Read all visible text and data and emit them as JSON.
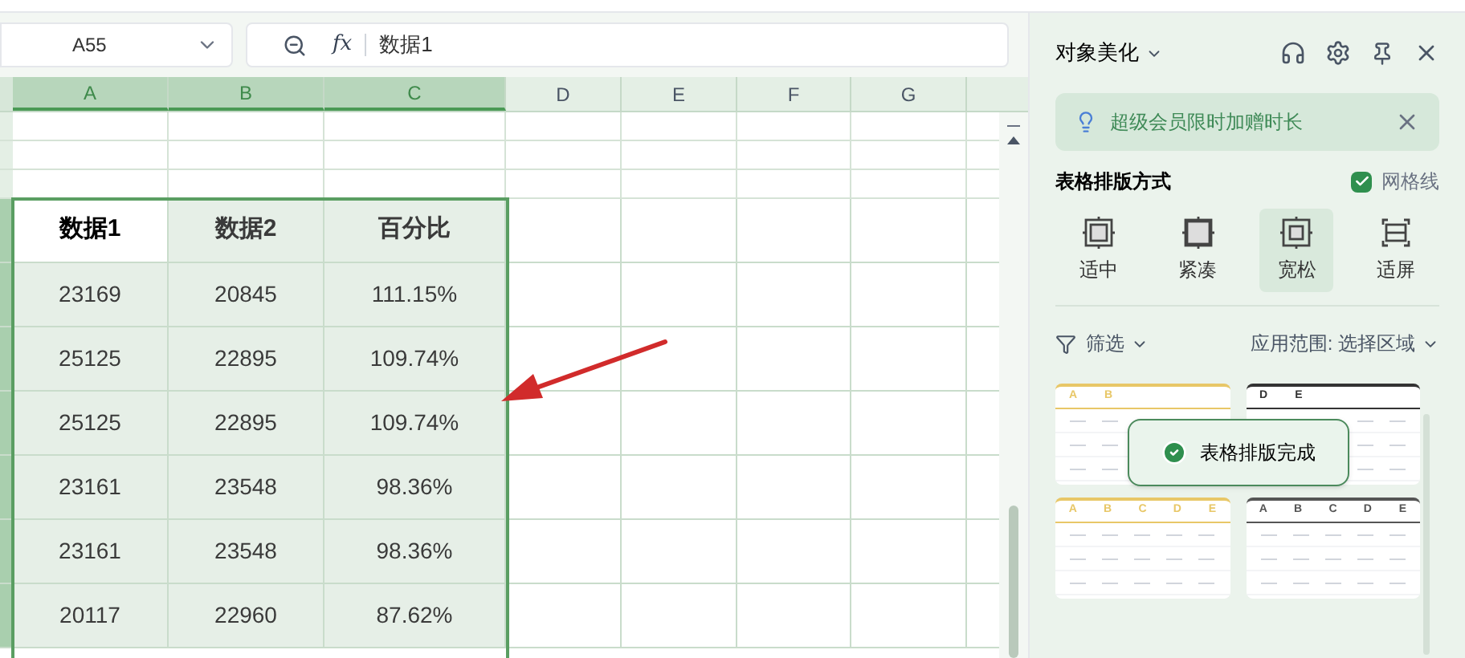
{
  "name_box": {
    "value": "A55"
  },
  "formula_bar": {
    "fx_label": "fx",
    "value": "数据1"
  },
  "columns": [
    {
      "label": "A",
      "selected": true
    },
    {
      "label": "B",
      "selected": true
    },
    {
      "label": "C",
      "selected": true
    },
    {
      "label": "D",
      "selected": false
    },
    {
      "label": "E",
      "selected": false
    },
    {
      "label": "F",
      "selected": false
    },
    {
      "label": "G",
      "selected": false
    }
  ],
  "table": {
    "headers": [
      "数据1",
      "数据2",
      "百分比"
    ],
    "rows": [
      [
        "23169",
        "20845",
        "111.15%"
      ],
      [
        "25125",
        "22895",
        "109.74%"
      ],
      [
        "25125",
        "22895",
        "109.74%"
      ],
      [
        "23161",
        "23548",
        "98.36%"
      ],
      [
        "23161",
        "23548",
        "98.36%"
      ],
      [
        "20117",
        "22960",
        "87.62%"
      ]
    ]
  },
  "panel": {
    "title": "对象美化",
    "banner": "超级会员限时加赠时长",
    "section_title": "表格排版方式",
    "gridlines": {
      "label": "网格线",
      "checked": true
    },
    "layouts": [
      {
        "label": "适中",
        "kind": "medium",
        "selected": false
      },
      {
        "label": "紧凑",
        "kind": "compact",
        "selected": false
      },
      {
        "label": "宽松",
        "kind": "loose",
        "selected": true
      },
      {
        "label": "适屏",
        "kind": "fit",
        "selected": false
      }
    ],
    "filter": "筛选",
    "scope": "应用范围: 选择区域",
    "thumbnails": [
      {
        "letters": [
          "A",
          "B"
        ],
        "color": "#e8c767"
      },
      {
        "letters": [
          "D",
          "E"
        ],
        "color": "#333333"
      },
      {
        "letters": [
          "A",
          "B",
          "C",
          "D",
          "E"
        ],
        "color": "#e8c767"
      },
      {
        "letters": [
          "A",
          "B",
          "C",
          "D",
          "E"
        ],
        "color": "#555555"
      }
    ],
    "toast": "表格排版完成"
  }
}
